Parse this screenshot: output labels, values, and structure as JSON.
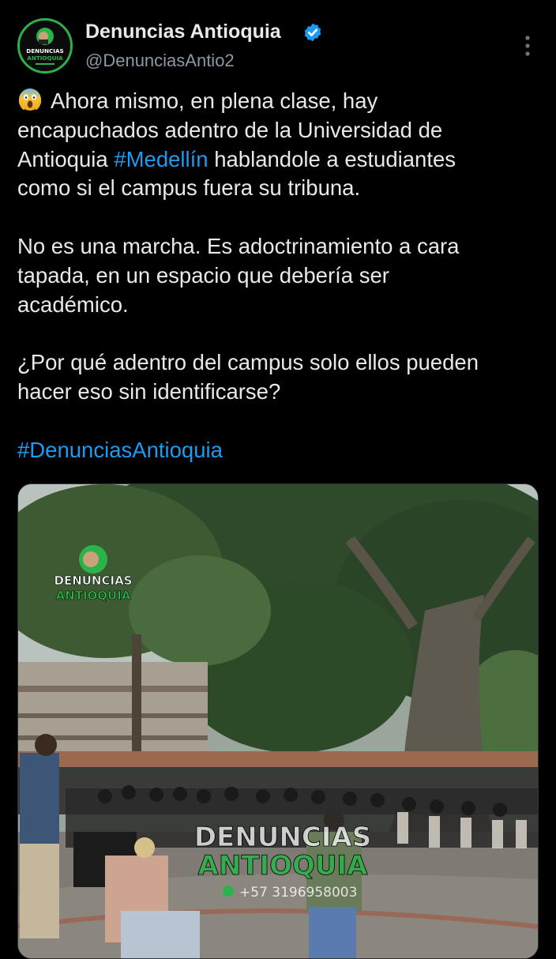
{
  "post": {
    "display_name": "Denuncias Antioquia",
    "handle": "@DenunciasAntio2",
    "verified": true,
    "avatar_label_top": "DENUNCIAS",
    "avatar_label_bottom": "ANTIOQUIA",
    "icons": {
      "avatar": "avatar-logo",
      "verified": "verified-badge-icon",
      "more": "more-options-icon",
      "emoji": "face-screaming-in-fear-emoji"
    },
    "text": {
      "p1_before": "Ahora mismo, en plena clase, hay\nencapuchados adentro de la Universidad de\nAntioquia ",
      "p1_hashtag": "#Medellín",
      "p1_after": " hablandole a estudiantes\ncomo si el campus fuera su tribuna.",
      "p2": "No es una marcha. Es adoctrinamiento a cara\ntapada, en un espacio que debería ser\nacadémico.",
      "p3": "¿Por qué adentro del campus solo ellos pueden\nhacer eso sin identificarse?",
      "hashtag_final": "#DenunciasAntioquia"
    },
    "colors": {
      "background": "#000000",
      "text": "#e7e9ea",
      "secondary": "#8b98a5",
      "link": "#1d9bf0",
      "brand_green": "#2bb34a"
    }
  },
  "media": {
    "description_type": "video-frame",
    "watermark_top_line1": "DENUNCIAS",
    "watermark_top_line2": "ANTIOQUIA",
    "watermark_center_line1": "DENUNCIAS",
    "watermark_center_line2": "ANTIOQUIA",
    "watermark_phone": "+57 3196958003"
  }
}
